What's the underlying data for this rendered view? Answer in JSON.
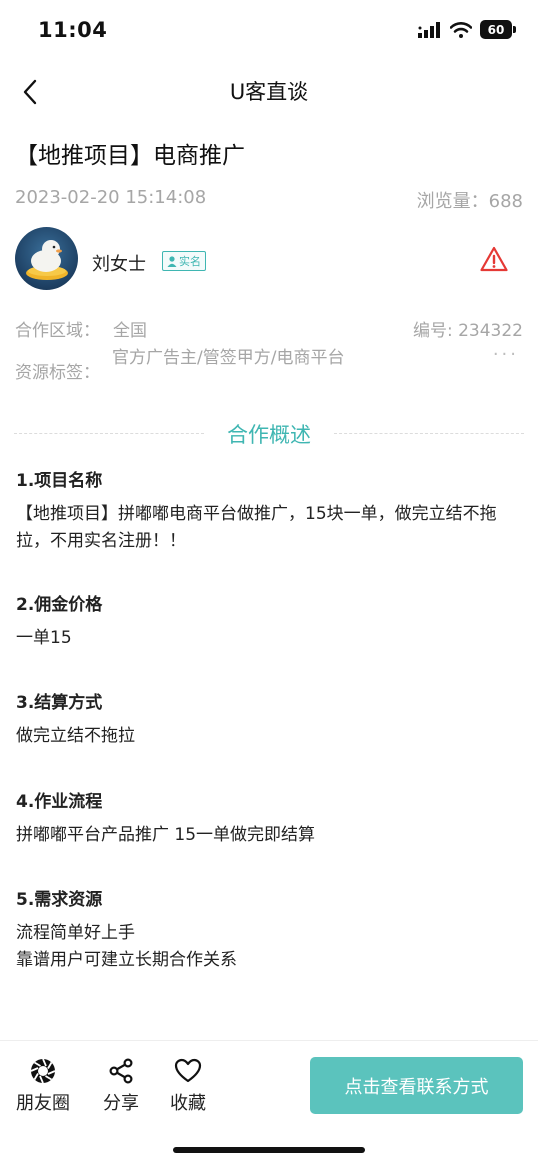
{
  "status_bar": {
    "time": "11:04",
    "battery": "60"
  },
  "nav": {
    "title": "U客直谈"
  },
  "post": {
    "title": "【地推项目】电商推广",
    "date": "2023-02-20 15:14:08",
    "views": "浏览量：688"
  },
  "author": {
    "name": "刘女士",
    "badge": "实名"
  },
  "info": {
    "region_label": "合作区域：",
    "region_value": "全国",
    "serial": "编号: 234322",
    "tags_label": "资源标签：",
    "tags_value": "官方广告主/管签甲方/电商平台",
    "more": "···"
  },
  "section": {
    "title": "合作概述"
  },
  "items": [
    {
      "heading": "1.项目名称",
      "body": [
        "【地推项目】拼嘟嘟电商平台做推广，15块一单，做完立结不拖拉，不用实名注册！！"
      ]
    },
    {
      "heading": "2.佣金价格",
      "body": [
        "一单15"
      ]
    },
    {
      "heading": "3.结算方式",
      "body": [
        "做完立结不拖拉"
      ]
    },
    {
      "heading": "4.作业流程",
      "body": [
        "拼嘟嘟平台产品推广 15一单做完即结算"
      ]
    },
    {
      "heading": "5.需求资源",
      "body": [
        "流程简单好上手",
        "靠谱用户可建立长期合作关系"
      ]
    }
  ],
  "bottom_bar": {
    "moments": "朋友圈",
    "share": "分享",
    "favorite": "收藏",
    "contact": "点击查看联系方式"
  },
  "colors": {
    "accent": "#3fb6b2",
    "button": "#5bc3bd",
    "warning": "#e53935",
    "muted": "#a6a6a6"
  }
}
